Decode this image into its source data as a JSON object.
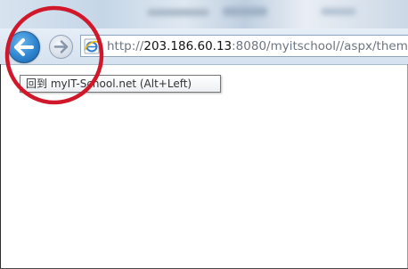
{
  "browser": {
    "address_bar": {
      "protocol": "http://",
      "host": "203.186.60.13",
      "rest": ":8080/myitschool//aspx/them"
    },
    "back_tooltip": "回到 myIT-School.net (Alt+Left)",
    "icons": {
      "back": "back-arrow-icon",
      "forward": "forward-arrow-icon",
      "page": "ie-page-icon"
    },
    "colors": {
      "annotation_circle": "#d0182a",
      "back_button": "#2f86d0"
    }
  }
}
